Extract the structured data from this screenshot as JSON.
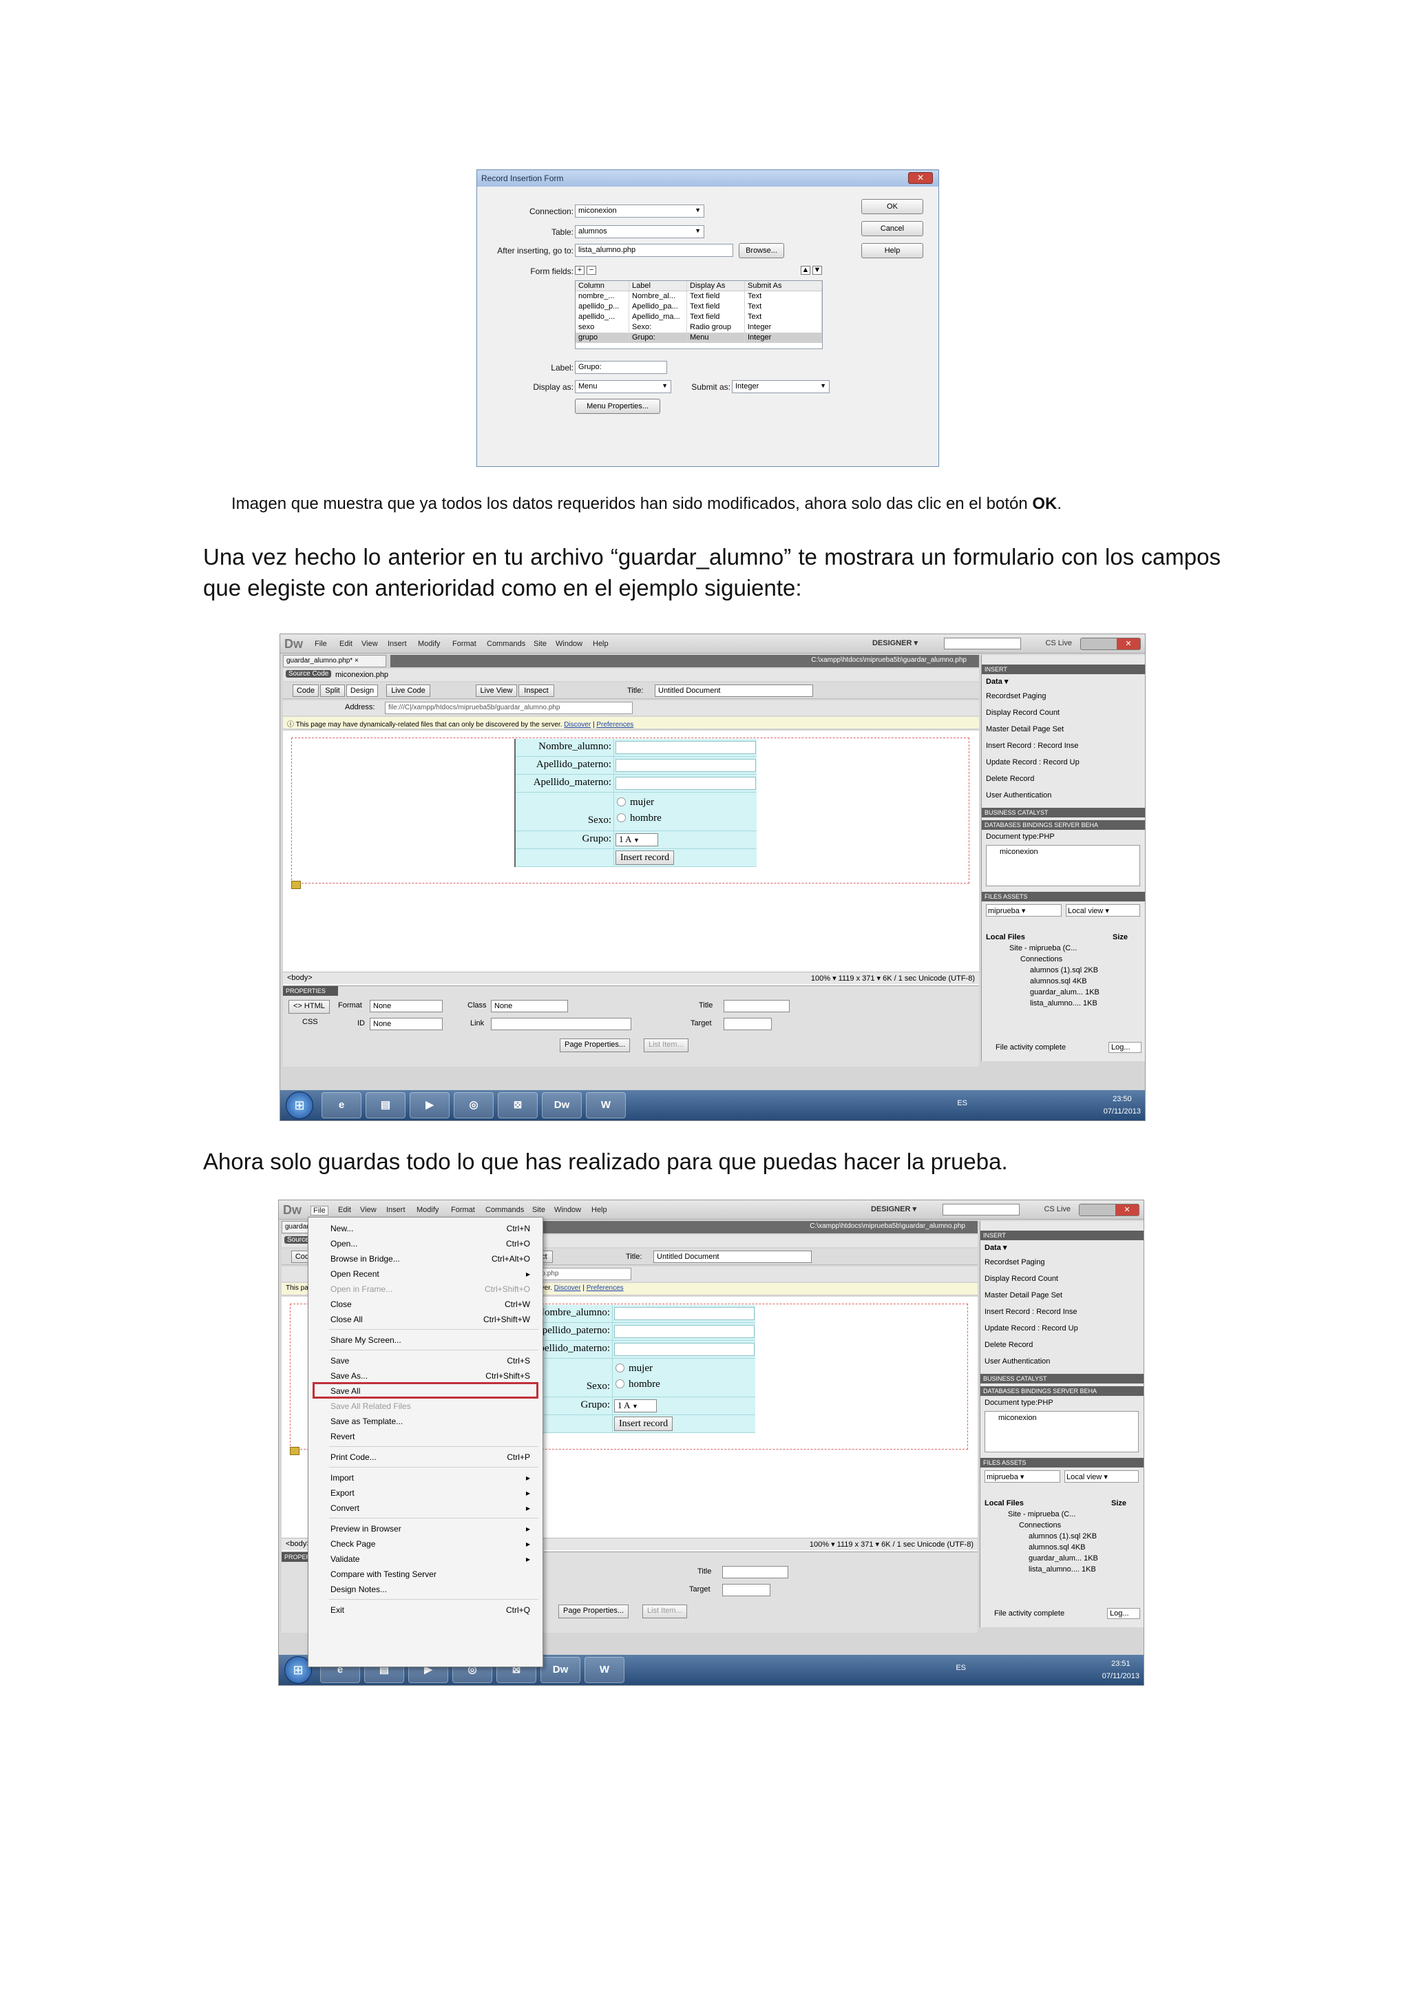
{
  "dialog": {
    "title": "Record Insertion Form",
    "close": "✕",
    "connection_label": "Connection:",
    "connection_value": "miconexion",
    "table_label": "Table:",
    "table_value": "alumnos",
    "after_label": "After inserting, go to:",
    "after_value": "lista_alumno.php",
    "browse": "Browse...",
    "formfields_label": "Form fields:",
    "columns": [
      "Column",
      "Label",
      "Display As",
      "Submit As"
    ],
    "rows": [
      [
        "nombre_...",
        "Nombre_al...",
        "Text field",
        "Text"
      ],
      [
        "apellido_p...",
        "Apellido_pa...",
        "Text field",
        "Text"
      ],
      [
        "apellido_...",
        "Apellido_ma...",
        "Text field",
        "Text"
      ],
      [
        "sexo",
        "Sexo:",
        "Radio group",
        "Integer"
      ],
      [
        "grupo",
        "Grupo:",
        "Menu",
        "Integer"
      ]
    ],
    "label_label": "Label:",
    "label_value": "Grupo:",
    "display_label": "Display as:",
    "display_value": "Menu",
    "submit_label": "Submit as:",
    "submit_value": "Integer",
    "menu_props": "Menu Properties...",
    "ok": "OK",
    "cancel": "Cancel",
    "help": "Help"
  },
  "text": {
    "caption": "Imagen que muestra que ya todos los datos requeridos han sido modificados, ahora solo das clic en el botón ",
    "caption_bold": "OK",
    "caption_end": ".",
    "para1": "Una vez hecho lo anterior en tu archivo “guardar_alumno” te mostrara un formulario con los campos que elegiste con anterioridad como en el ejemplo siguiente:",
    "para2": "Ahora solo guardas todo lo que has realizado para que puedas hacer la prueba."
  },
  "dw": {
    "logo": "Dw",
    "menus": [
      "File",
      "Edit",
      "View",
      "Insert",
      "Modify",
      "Format",
      "Commands",
      "Site",
      "Window",
      "Help"
    ],
    "designer": "DESIGNER ▾",
    "cslive": "CS Live",
    "doc_tab": "guardar_alumno.php* ×",
    "doc_path": "C:\\xampp\\htdocs\\miprueba5b\\guardar_alumno.php",
    "source_code": "Source Code",
    "source_file": "miconexion.php",
    "views": [
      "Code",
      "Split",
      "Design",
      "Live Code",
      "Live View",
      "Inspect"
    ],
    "title_label": "Title:",
    "title_value": "Untitled Document",
    "address_label": "Address:",
    "address_value": "file:///C|/xampp/htdocs/miprueba5b/guardar_alumno.php",
    "info_text": "This page may have dynamically-related files that can only be discovered by the server.",
    "info_discover": "Discover",
    "info_sep": "|",
    "info_prefs": "Preferences",
    "form": {
      "nombre": "Nombre_alumno:",
      "paterno": "Apellido_paterno:",
      "materno": "Apellido_materno:",
      "mujer": "mujer",
      "hombre": "hombre",
      "sexo": "Sexo:",
      "grupo": "Grupo:",
      "grupo_value": "1 A",
      "insert": "Insert record"
    },
    "status_tag": "<body>",
    "status_right": "100%  ▾  1119 x 371 ▾  6K / 1 sec  Unicode (UTF-8)",
    "props_header": "PROPERTIES",
    "props_html": "<> HTML",
    "props_css": "CSS",
    "props_format": "Format",
    "props_none": "None",
    "props_class": "Class",
    "props_id": "ID",
    "props_link": "Link",
    "props_title": "Title",
    "props_target": "Target",
    "props_page": "Page Properties...",
    "props_list": "List Item...",
    "panel": {
      "insert": "INSERT",
      "data": "Data ▾",
      "items": [
        "Recordset Paging",
        "Display Record Count",
        "Master Detail Page Set",
        "Insert Record : Record Inse",
        "Update Record : Record Up",
        "Delete Record",
        "User Authentication"
      ],
      "business": "BUSINESS CATALYST",
      "databases": "DATABASES  BINDINGS  SERVER BEHA",
      "doctype": "Document type:PHP",
      "conn": "miconexion",
      "files_tab": "FILES  ASSETS",
      "site": "miprueba ▾",
      "localview": "Local view ▾",
      "local_files": "Local Files",
      "size": "Size",
      "tree": [
        "Site - miprueba (C...",
        "Connections",
        "alumnos (1).sql   2KB",
        "alumnos.sql   4KB",
        "guardar_alum...   1KB",
        "lista_alumno....   1KB"
      ],
      "activity": "File activity complete",
      "log": "Log..."
    },
    "taskbar": {
      "lang": "ES",
      "time1": "23:50",
      "time2": "23:51",
      "date": "07/11/2013",
      "dw": "Dw",
      "w": "W"
    }
  },
  "filemenu": {
    "items": [
      {
        "label": "New...",
        "key": "Ctrl+N"
      },
      {
        "label": "Open...",
        "key": "Ctrl+O"
      },
      {
        "label": "Browse in Bridge...",
        "key": "Ctrl+Alt+O"
      },
      {
        "label": "Open Recent",
        "key": "▸"
      },
      {
        "label": "Open in Frame...",
        "key": "Ctrl+Shift+O"
      },
      {
        "label": "Close",
        "key": "Ctrl+W"
      },
      {
        "label": "Close All",
        "key": "Ctrl+Shift+W"
      },
      {
        "label": "Share My Screen...",
        "key": ""
      },
      {
        "label": "Save",
        "key": "Ctrl+S"
      },
      {
        "label": "Save As...",
        "key": "Ctrl+Shift+S"
      },
      {
        "label": "Save All",
        "key": ""
      },
      {
        "label": "Save All Related Files",
        "key": ""
      },
      {
        "label": "Save as Template...",
        "key": ""
      },
      {
        "label": "Revert",
        "key": ""
      },
      {
        "label": "Print Code...",
        "key": "Ctrl+P"
      },
      {
        "label": "Import",
        "key": "▸"
      },
      {
        "label": "Export",
        "key": "▸"
      },
      {
        "label": "Convert",
        "key": "▸"
      },
      {
        "label": "Preview in Browser",
        "key": "▸"
      },
      {
        "label": "Check Page",
        "key": "▸"
      },
      {
        "label": "Validate",
        "key": "▸"
      },
      {
        "label": "Compare with Testing Server",
        "key": ""
      },
      {
        "label": "Design Notes...",
        "key": ""
      },
      {
        "label": "Exit",
        "key": "Ctrl+Q"
      }
    ]
  }
}
